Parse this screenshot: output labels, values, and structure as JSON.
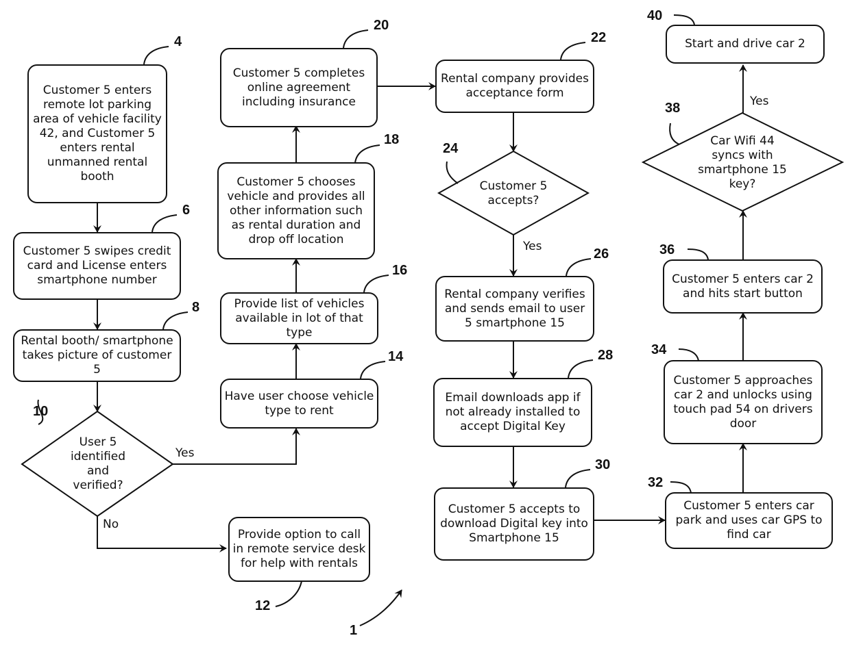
{
  "diagram": {
    "steps": {
      "s4": {
        "ref": "4",
        "text": "Customer 5 enters remote lot parking area of vehicle facility 42, and Customer 5 enters rental unmanned rental booth"
      },
      "s6": {
        "ref": "6",
        "text": "Customer 5 swipes credit card and License enters smartphone number"
      },
      "s8": {
        "ref": "8",
        "text": "Rental booth/ smartphone takes picture of customer 5"
      },
      "s10": {
        "ref": "10",
        "text": "User 5 identified and verified?"
      },
      "s12": {
        "ref": "12",
        "text": "Provide option to call in remote service desk for help with rentals"
      },
      "s14": {
        "ref": "14",
        "text": "Have user choose vehicle type to rent"
      },
      "s16": {
        "ref": "16",
        "text": "Provide list of vehicles available in lot of that type"
      },
      "s18": {
        "ref": "18",
        "text": "Customer 5 chooses vehicle and provides all other information such as rental duration and drop off location"
      },
      "s20": {
        "ref": "20",
        "text": "Customer 5 completes online agreement including insurance"
      },
      "s22": {
        "ref": "22",
        "text": "Rental company provides acceptance form"
      },
      "s24": {
        "ref": "24",
        "text": "Customer 5 accepts?"
      },
      "s26": {
        "ref": "26",
        "text": "Rental company verifies and sends email to user 5 smartphone 15"
      },
      "s28": {
        "ref": "28",
        "text": "Email downloads app if not already installed to accept Digital Key"
      },
      "s30": {
        "ref": "30",
        "text": "Customer 5 accepts to download Digital key into Smartphone 15"
      },
      "s32": {
        "ref": "32",
        "text": "Customer 5 enters car park and uses car GPS to find car"
      },
      "s34": {
        "ref": "34",
        "text": "Customer 5 approaches car 2 and unlocks using touch pad 54 on drivers door"
      },
      "s36": {
        "ref": "36",
        "text": "Customer 5 enters car 2 and hits start button"
      },
      "s38": {
        "ref": "38",
        "text": "Car Wifi 44 syncs with smartphone 15 key?"
      },
      "s40": {
        "ref": "40",
        "text": "Start and drive car 2"
      }
    },
    "labels": {
      "yes_10": "Yes",
      "no_10": "No",
      "yes_24": "Yes",
      "yes_38": "Yes"
    },
    "figure_ref": "1"
  }
}
